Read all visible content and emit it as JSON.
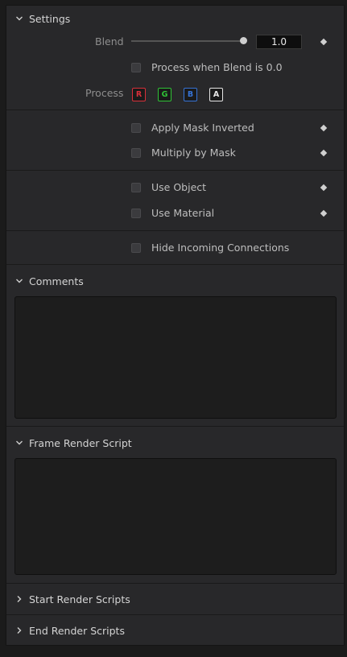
{
  "settings": {
    "header": "Settings",
    "blend_label": "Blend",
    "blend_value": "1.0",
    "blend_fraction": 1.0,
    "process_when_blend_zero": "Process when Blend is 0.0",
    "process_label": "Process",
    "channels": [
      {
        "label": "R",
        "color": "#d8303a"
      },
      {
        "label": "G",
        "color": "#2fc236"
      },
      {
        "label": "B",
        "color": "#3673d6"
      },
      {
        "label": "A",
        "color": "#e6e6e6"
      }
    ],
    "apply_mask_inverted": "Apply Mask Inverted",
    "multiply_by_mask": "Multiply by Mask",
    "use_object": "Use Object",
    "use_material": "Use Material",
    "hide_incoming_connections": "Hide Incoming Connections"
  },
  "comments": {
    "header": "Comments",
    "value": ""
  },
  "frame_render_script": {
    "header": "Frame Render Script",
    "value": ""
  },
  "start_render_scripts": {
    "header": "Start Render Scripts"
  },
  "end_render_scripts": {
    "header": "End Render Scripts"
  },
  "icons": {
    "expanded": "chevron-down-icon",
    "collapsed": "chevron-right-icon",
    "keyframe": "diamond-icon"
  }
}
